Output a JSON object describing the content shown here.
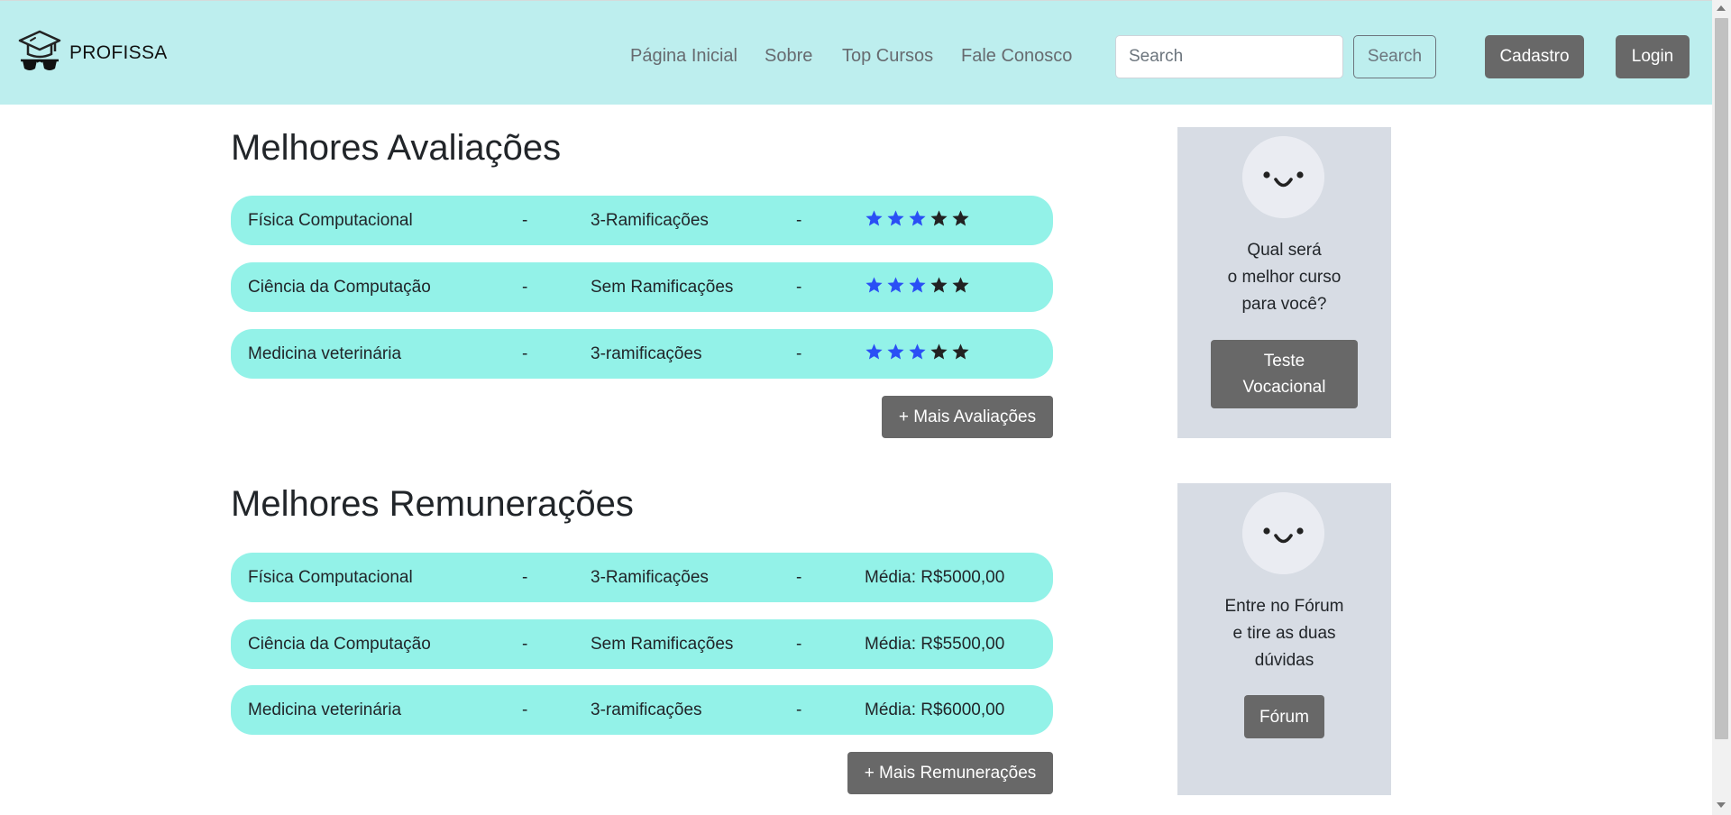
{
  "brand": {
    "name": "PROFISSA",
    "logo_icon": "graduate-cap-sunglasses-icon"
  },
  "nav": {
    "links": [
      "Página Inicial",
      "Sobre",
      "Top Cursos",
      "Fale Conosco"
    ],
    "search_placeholder": "Search",
    "search_button": "Search",
    "signup_button": "Cadastro",
    "login_button": "Login"
  },
  "ratings": {
    "title": "Melhores Avaliações",
    "rows": [
      {
        "course": "Física Computacional",
        "dash1": "-",
        "branches": "3-Ramificações",
        "dash2": "-",
        "rating": 3,
        "max": 5
      },
      {
        "course": "Ciência da Computação",
        "dash1": "-",
        "branches": "Sem Ramificações",
        "dash2": "-",
        "rating": 3,
        "max": 5
      },
      {
        "course": "Medicina veterinária",
        "dash1": "-",
        "branches": "3-ramificações",
        "dash2": "-",
        "rating": 3,
        "max": 5
      }
    ],
    "more_button": "+ Mais Avaliações"
  },
  "salaries": {
    "title": "Melhores Remunerações",
    "rows": [
      {
        "course": "Física Computacional",
        "dash1": "-",
        "branches": "3-Ramificações",
        "dash2": "-",
        "value": "Média: R$5000,00"
      },
      {
        "course": "Ciência da Computação",
        "dash1": "-",
        "branches": "Sem Ramificações",
        "dash2": "-",
        "value": "Média: R$5500,00"
      },
      {
        "course": "Medicina veterinária",
        "dash1": "-",
        "branches": "3-ramificações",
        "dash2": "-",
        "value": "Média: R$6000,00"
      }
    ],
    "more_button": "+ Mais Remunerações"
  },
  "vocational_card": {
    "icon": "smiley-face-icon",
    "text_lines": [
      "Qual será",
      "o melhor curso",
      "para você?"
    ],
    "button_lines": [
      "Teste",
      "Vocacional"
    ]
  },
  "forum_card": {
    "icon": "smiley-face-icon",
    "text_lines": [
      "Entre no Fórum",
      "e tire as duas",
      "dúvidas"
    ],
    "button": "Fórum"
  },
  "colors": {
    "navbar": "#bdeeee",
    "row": "#93f2e8",
    "star_active": "#2a4ff5",
    "star_inactive": "#222222",
    "button_dark": "#686868",
    "card": "#d7dce4"
  }
}
